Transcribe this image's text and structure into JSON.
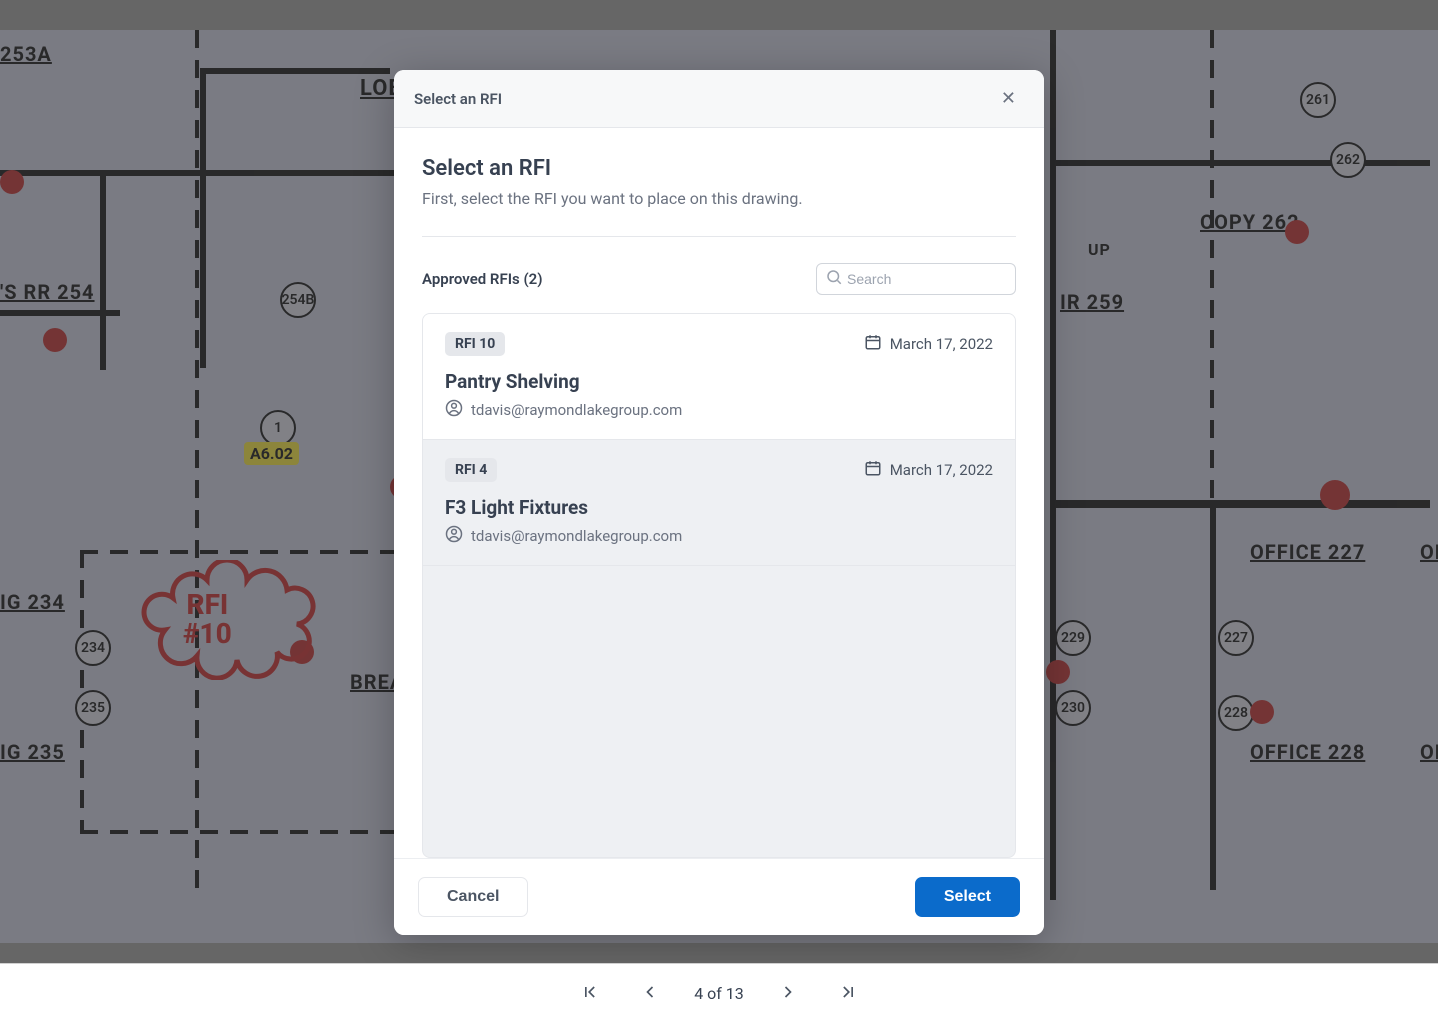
{
  "background": {
    "room_labels": {
      "r253a": "253A",
      "rr254": "'S RR  254",
      "r254b": "254B",
      "lob": "LOB",
      "copy262": "COPY  262",
      "ir259": "IR  259",
      "up": "UP",
      "ig234": "IG  234",
      "brea": "BREA",
      "ig235": "IG  235",
      "office227": "OFFICE  227",
      "office228": "OFFICE  228",
      "of_right": "OF",
      "c261": "261",
      "c262": "262",
      "c229": "229",
      "c227": "227",
      "c228": "228",
      "c230": "230",
      "c234": "234",
      "c235": "235",
      "c_one": "1",
      "a602": "A6.02"
    },
    "rfi_cloud": {
      "line1": "RFI",
      "line2": "#10"
    }
  },
  "modal": {
    "header_title": "Select an RFI",
    "title": "Select an RFI",
    "subtitle": "First, select the RFI you want to place on this drawing.",
    "list_label": "Approved RFIs (2)",
    "search_placeholder": "Search",
    "items": [
      {
        "badge": "RFI 10",
        "date": "March 17, 2022",
        "title": "Pantry Shelving",
        "email": "tdavis@raymondlakegroup.com",
        "selected": true
      },
      {
        "badge": "RFI 4",
        "date": "March 17, 2022",
        "title": "F3 Light Fixtures",
        "email": "tdavis@raymondlakegroup.com",
        "selected": false
      }
    ],
    "cancel": "Cancel",
    "select": "Select"
  },
  "pager": {
    "label": "4 of 13"
  }
}
